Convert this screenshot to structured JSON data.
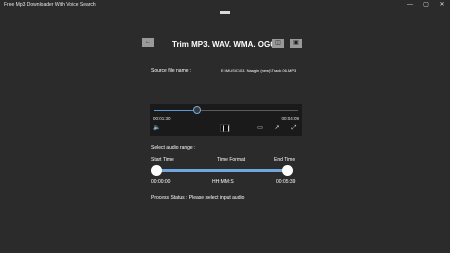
{
  "window": {
    "title": "Free Mp3 Downloader With Voice Search",
    "minimize_glyph": "—",
    "maximize_glyph": "▢",
    "close_glyph": "✕"
  },
  "header": {
    "back_glyph": "←",
    "title": "Trim MP3. WAV. WMA. OGG",
    "btn1_glyph": "◫",
    "btn2_glyph": "▣"
  },
  "source": {
    "label": "Source file name :",
    "value": "E:\\MUSIC\\03. Naagin (new)\\Track 06.MP3"
  },
  "player": {
    "position_fraction": 0.3,
    "current_time": "00:01:30",
    "total_time": "00:04:09",
    "volume_glyph": "🔈",
    "pause_glyph": "❙❙",
    "aspect_glyph": "▭",
    "cast_glyph": "↗",
    "fullscreen_glyph": "⤢"
  },
  "range": {
    "section_label": "Select audio range :",
    "start_label": "Start Time",
    "format_label": "Time Format",
    "end_label": "End Time",
    "start_value": "00:00:00",
    "format_value": "HH:MM:S",
    "end_value": "00:05:39"
  },
  "status": {
    "text": "Process Status : Please select input audio"
  },
  "colors": {
    "background": "#2b2b2b",
    "accent": "#6fa8dc",
    "button": "#9a9a9a"
  }
}
